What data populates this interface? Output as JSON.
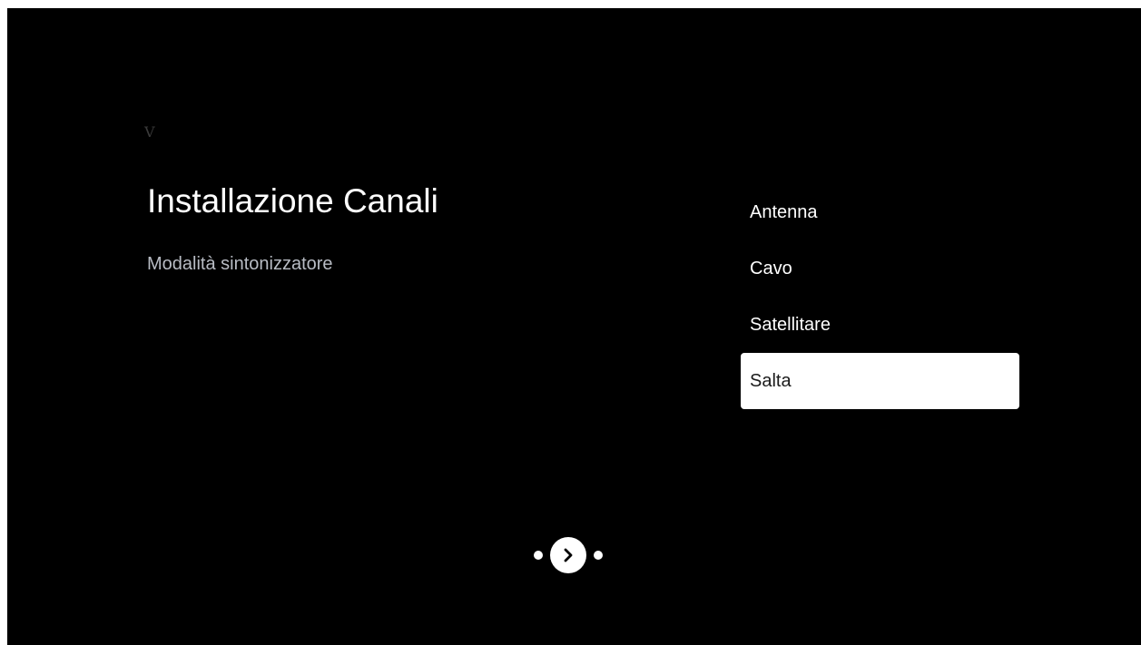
{
  "brand": {
    "mark": "V"
  },
  "header": {
    "title": "Installazione Canali",
    "subtitle": "Modalità sintonizzatore"
  },
  "options": [
    {
      "label": "Antenna",
      "selected": false
    },
    {
      "label": "Cavo",
      "selected": false
    },
    {
      "label": "Satellitare",
      "selected": false
    },
    {
      "label": "Salta",
      "selected": true
    }
  ],
  "pager": {
    "prev_dot_icon": "dot-icon",
    "next_icon": "chevron-right-icon",
    "next_dot_icon": "dot-icon"
  },
  "colors": {
    "background": "#000000",
    "text": "#ffffff",
    "subtitle": "#b8bcc4",
    "selected_bg": "#ffffff",
    "selected_text": "#1a1a1a"
  }
}
